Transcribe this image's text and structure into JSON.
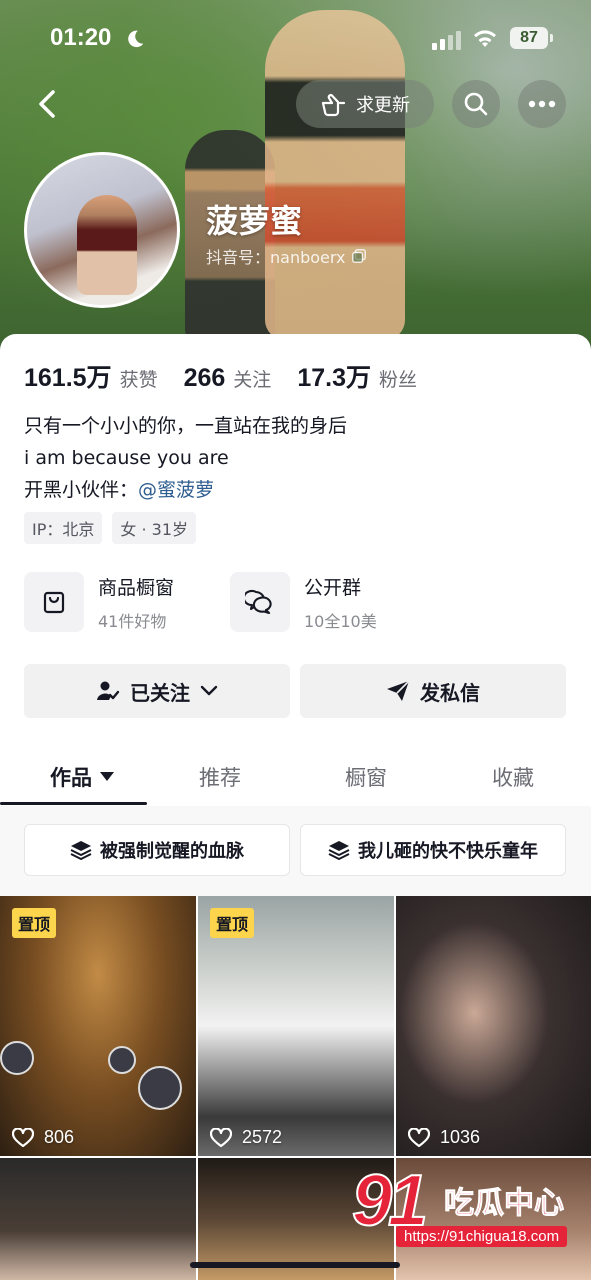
{
  "status_bar": {
    "time": "01:20",
    "battery": "87"
  },
  "header": {
    "update_label": "求更新"
  },
  "profile": {
    "nickname": "菠萝蜜",
    "douyin_id": "抖音号：nanboerx"
  },
  "stats": [
    {
      "value": "161.5万",
      "label": "获赞"
    },
    {
      "value": "266",
      "label": "关注"
    },
    {
      "value": "17.3万",
      "label": "粉丝"
    }
  ],
  "bio": {
    "line1": "只有一个小小的你，一直站在我的身后",
    "line2": "i am because you are",
    "line3_prefix": "开黑小伙伴：",
    "line3_link": "@蜜菠萝"
  },
  "tags": [
    "IP：北京",
    "女 · 31岁"
  ],
  "features": [
    {
      "title": "商品橱窗",
      "subtitle": "41件好物",
      "icon": "shopping-bag-icon"
    },
    {
      "title": "公开群",
      "subtitle": "10全10美",
      "icon": "chat-group-icon"
    }
  ],
  "actions": {
    "follow_label": "已关注",
    "message_label": "发私信"
  },
  "tabs": [
    "作品",
    "推荐",
    "橱窗",
    "收藏"
  ],
  "collections": [
    "被强制觉醒的血脉",
    "我儿砸的快不快乐童年"
  ],
  "videos": [
    {
      "pinned": true,
      "pin_label": "置顶",
      "likes": "806"
    },
    {
      "pinned": true,
      "pin_label": "置顶",
      "likes": "2572"
    },
    {
      "pinned": false,
      "likes": "1036"
    }
  ],
  "watermark": {
    "number": "91",
    "text": "吃瓜中心",
    "url": "https://91chigua18.com"
  },
  "colors": {
    "accent_link": "#2e5d8f",
    "pin_badge": "#fdd54c",
    "watermark_red": "#e5243a"
  }
}
